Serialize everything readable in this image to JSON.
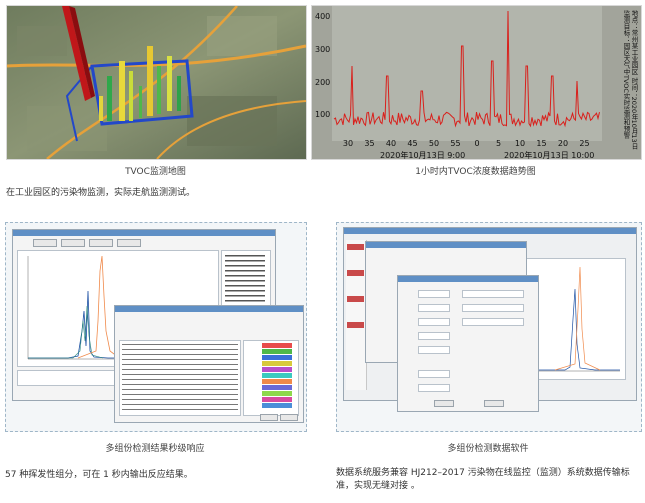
{
  "top": {
    "left_caption": "TVOC监测地图",
    "right_caption": "1小时内TVOC浓度数据趋势图",
    "description": "在工业园区的污染物监测，实际走航监测测试。",
    "trend_chart": {
      "type": "line",
      "y_ticks": [
        "400",
        "300",
        "200",
        "100"
      ],
      "x_ticks": [
        "30",
        "35",
        "40",
        "45",
        "50",
        "55",
        "0",
        "5",
        "10",
        "15",
        "20",
        "25"
      ],
      "time_labels": [
        "2020年10月13日 9:00",
        "2020年10月13日 10:00"
      ],
      "annotation": "地点：常州某工业园区  时间：2020年10月13日  监测目标：园区大气中TVOC实时监测和预警",
      "colors": {
        "line": "#d9201c"
      }
    }
  },
  "bottom_left": {
    "caption": "多组份检测结果秒级响应",
    "description": "57 种挥发性组分，可在 1 秒内输出反应结果。"
  },
  "bottom_right": {
    "caption": "多组份检测数据软件",
    "description": "数据系统服务兼容 HJ212–2017 污染物在线监控（监测）系统数据传输标准，实现无缝对接 。"
  },
  "icons": {
    "tower": "3d-bar-icon"
  },
  "colors": {
    "frame_border": "#9fb6c8",
    "spectrum_blue": "#1b4fa3",
    "spectrum_orange": "#f08a4b"
  }
}
